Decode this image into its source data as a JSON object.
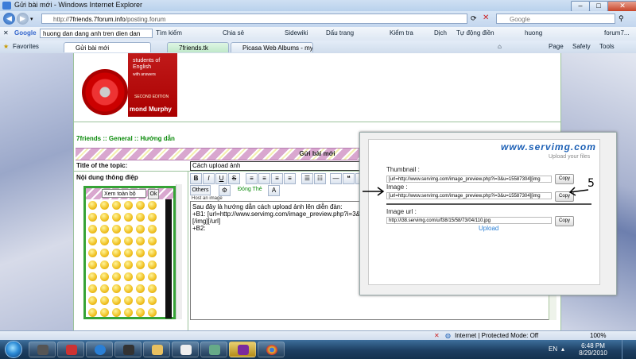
{
  "window": {
    "title": "Gửi bài mới - Windows Internet Explorer",
    "min_label": "–",
    "max_label": "□",
    "close_label": "✕"
  },
  "address": {
    "url_prefix": "http://",
    "url_domain": "7friends.7forum.info",
    "url_path": "/posting.forum",
    "search_placeholder": "Google"
  },
  "google_toolbar": {
    "label": "Google",
    "query": "huong dan dang anh tren dien dan",
    "items": [
      "Tìm kiếm",
      "Chia sẻ",
      "Sidewiki",
      "Dấu trang",
      "Kiểm tra",
      "Dịch",
      "Tự động điền",
      "huong",
      "forum7..."
    ]
  },
  "favorites": {
    "label": "Favorites",
    "tabs": [
      "Gửi bài mới",
      "7friends.tk",
      "Picasa Web Albums - my7..."
    ],
    "commands": [
      "Page",
      "Safety",
      "Tools"
    ]
  },
  "book": {
    "line1": "students of",
    "line2": "English",
    "line3": "with answers",
    "edition": "SECOND EDITION",
    "author": "mond Murphy"
  },
  "forum": {
    "breadcrumb": "7friends  :: General :: Hướng dẫn",
    "post_title": "Gửi bài mới",
    "topic_label": "Title of the topic:",
    "topic_value": "Cách upload ảnh",
    "message_label": "Nội dung thông điệp",
    "others_label": "Others",
    "font_label": "Đóng Thẻ",
    "host_label": "Host an image",
    "message_lines": [
      "Sau đây là hướng dẫn cách upload ảnh lên diễn đàn:",
      "+B1: [url=http://www.servimg.com/image_preview.php?i=3&u=",
      "[/img][/url]",
      "+B2:"
    ],
    "editor_buttons": [
      "B",
      "I",
      "U",
      "S"
    ],
    "smilies_select": "Xem toàn bộ",
    "smilies_ok": "Ok"
  },
  "servimg": {
    "logo": "www.servimg.com",
    "tagline": "Upload your files",
    "thumbnail_label": "Thumbnail :",
    "thumbnail_value": "[url=http://www.servimg.com/image_preview.php?i=3&u=15587304][img",
    "image_label": "Image :",
    "image_value": "[url=http://www.servimg.com/image_preview.php?i=3&u=15587304][img",
    "imageurl_label": "Image url :",
    "imageurl_value": "http://i38.servimg.com/u/f38/15/58/73/04/110.jpg",
    "copy_label": "Copy",
    "upload_label": "Upload",
    "annotation": "5"
  },
  "status": {
    "zone": "Internet | Protected Mode: Off",
    "zoom": "100%"
  },
  "taskbar": {
    "lang": "EN",
    "time": "6:48 PM",
    "date": "8/29/2010"
  }
}
